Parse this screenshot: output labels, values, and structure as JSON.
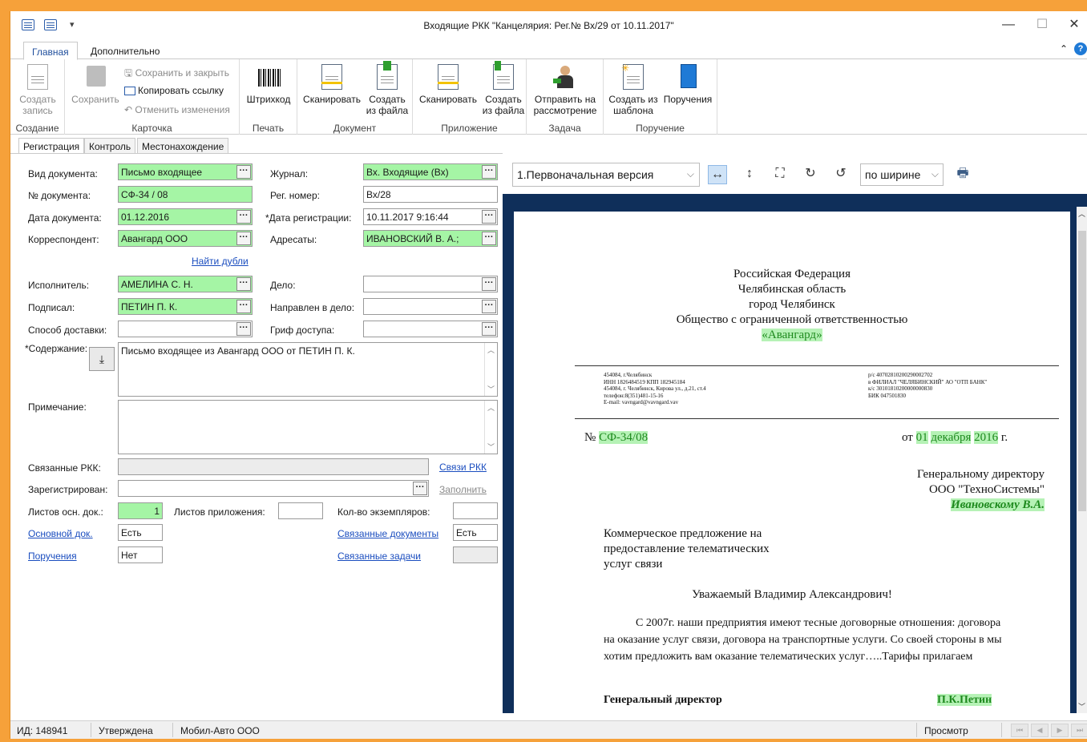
{
  "window": {
    "title": "Входящие РКК \"Канцелярия: Рег.№ Вх/29 от 10.11.2017\"",
    "minimize": "—",
    "maximize": "☐",
    "close": "✕"
  },
  "ribbon_tabs": {
    "main": "Главная",
    "extra": "Дополнительно",
    "help": "?"
  },
  "ribbon": {
    "create": {
      "label": "Создать запись",
      "group": "Создание"
    },
    "card": {
      "save": "Сохранить",
      "save_close": "Сохранить и закрыть",
      "copy_link": "Копировать ссылку",
      "cancel": "Отменить изменения",
      "group": "Карточка"
    },
    "print": {
      "barcode": "Штрихкод",
      "group": "Печать"
    },
    "document": {
      "scan": "Сканировать",
      "from_file": "Создать из файла",
      "group": "Документ"
    },
    "attachment": {
      "scan": "Сканировать",
      "from_file": "Создать из файла",
      "group": "Приложение"
    },
    "task": {
      "send": "Отправить на рассмотрение",
      "group": "Задача"
    },
    "assignment": {
      "from_template": "Создать из шаблона",
      "assignments": "Поручения",
      "group": "Поручение"
    }
  },
  "subtabs": [
    "Регистрация",
    "Контроль",
    "Местонахождение"
  ],
  "form": {
    "doc_type": {
      "label": "Вид документа:",
      "value": "Письмо входящее"
    },
    "doc_number": {
      "label": "№ документа:",
      "value": "СФ-34 / 08"
    },
    "doc_date": {
      "label": "Дата документа:",
      "value": "01.12.2016"
    },
    "correspondent": {
      "label": "Корреспондент:",
      "value": "Авангард ООО"
    },
    "find_duplicates": "Найти дубли",
    "journal": {
      "label": "Журнал:",
      "value": "Вх. Входящие (Вх)"
    },
    "reg_number": {
      "label": "Рег. номер:",
      "value": "Вх/28"
    },
    "reg_date": {
      "label": "*Дата регистрации:",
      "value": "10.11.2017 9:16:44"
    },
    "addressees": {
      "label": "Адресаты:",
      "value": "ИВАНОВСКИЙ В. А.;"
    },
    "executor": {
      "label": "Исполнитель:",
      "value": "АМЕЛИНА С. Н."
    },
    "signed": {
      "label": "Подписал:",
      "value": "ПЕТИН П. К."
    },
    "delivery": {
      "label": "Способ доставки:",
      "value": ""
    },
    "case": {
      "label": "Дело:",
      "value": ""
    },
    "sent_to_case": {
      "label": "Направлен в дело:",
      "value": ""
    },
    "access": {
      "label": "Гриф доступа:",
      "value": ""
    },
    "content": {
      "label": "*Содержание:",
      "value": "Письмо входящее из Авангард ООО от ПЕТИН П. К."
    },
    "note": {
      "label": "Примечание:",
      "value": ""
    },
    "linked_rkk": {
      "label": "Связанные РКК:",
      "link": "Связи РКК",
      "value": ""
    },
    "registered_in": {
      "label": "Зарегистрирован:",
      "link": "Заполнить",
      "value": ""
    },
    "main_sheets": {
      "label": "Листов осн. док.:",
      "value": "1"
    },
    "attach_sheets": {
      "label": "Листов приложения:",
      "value": ""
    },
    "copies": {
      "label": "Кол-во экземпляров:",
      "value": ""
    },
    "main_doc": {
      "link": "Основной док.",
      "value": "Есть"
    },
    "related_docs": {
      "link": "Связанные документы",
      "value": "Есть"
    },
    "assignments": {
      "link": "Поручения",
      "value": "Нет"
    },
    "related_tasks": {
      "link": "Связанные задачи",
      "value": ""
    }
  },
  "viewer": {
    "version": "1.Первоначальная версия",
    "zoom_mode": "по ширине"
  },
  "letter": {
    "head1": "Российская Федерация",
    "head2": "Челябинская область",
    "head3": "город Челябинск",
    "head4": "Общество с ограниченной ответственностью",
    "org_name": "«Авангард»",
    "left_info": [
      "454084, г.Челябинск",
      "ИНН  1826484519  КПП  182945184",
      "454084, г. Челябинск, Кирова ул., д.21, ст.4",
      "телефон:8(351)481-15-16",
      "E-mail: vavngard@vavngard.vav"
    ],
    "right_info": [
      "р/с  40702810200290002702",
      "в ФИЛИАЛ \"ЧЕЛЯБИНСКИЙ\" АО \"ОТП БАНК\"",
      "к/с  30101810200000000830",
      "БИК  047501830"
    ],
    "number_prefix": "№ ",
    "number": "СФ-34/08",
    "date_prefix": "от ",
    "date_day": "01",
    "date_month": "декабря",
    "date_year": "2016",
    "date_suffix": " г.",
    "to1": "Генеральному директору",
    "to2": "ООО \"ТехноСистемы\"",
    "to3": "Ивановскому В.А.",
    "subject1": "Коммерческое предложение на",
    "subject2": "предоставление телематических",
    "subject3": "услуг связи",
    "greeting": "Уважаемый Владимир Александрович!",
    "body1": "С 2007г. наши предприятия имеют тесные договорные отношения: договора",
    "body2": "на оказание услуг связи, договора на транспортные услуги. Со своей стороны в мы",
    "body3": "хотим предложить вам оказание телематических услуг…..Тарифы прилагаем",
    "sign_title": "Генеральный директор",
    "sign_name": "П.К.Петин"
  },
  "statusbar": {
    "id": "ИД: 148941",
    "state": "Утверждена",
    "org": "Мобил-Авто ООО",
    "mode": "Просмотр"
  }
}
